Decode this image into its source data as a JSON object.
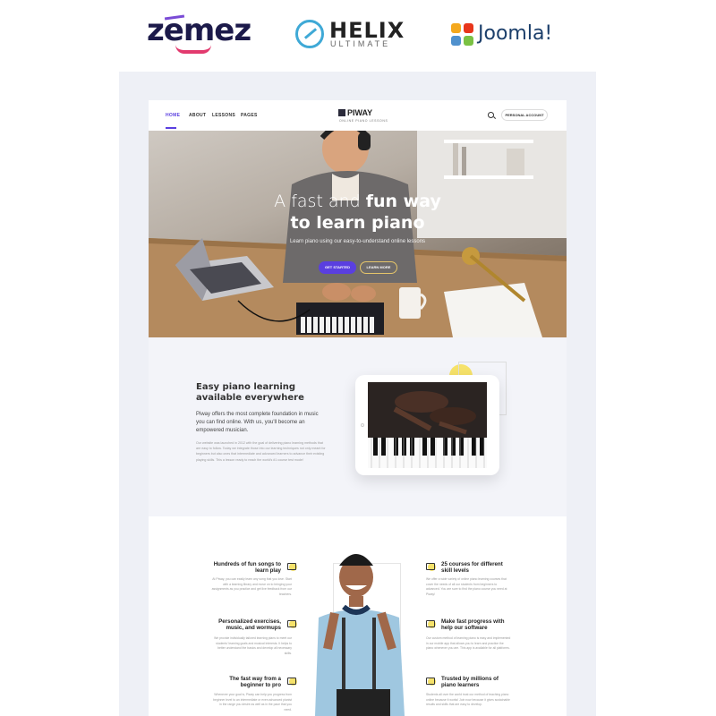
{
  "brands": {
    "zemez": "zemez",
    "helix": "HELIX",
    "helix_sub": "ULTIMATE",
    "joomla": "Joomla!"
  },
  "nav": {
    "items": [
      "Home",
      "About",
      "Lessons",
      "Pages"
    ],
    "active": "Home",
    "logo": "PIWAY",
    "logo_tagline": "ONLINE PIANO LESSONS",
    "account": "PERSONAL ACCOUNT",
    "search_icon": "search-icon"
  },
  "hero": {
    "title_light": "A fast and ",
    "title_bold": "fun way",
    "title_line2": "to learn piano",
    "subtitle": "Learn piano using our easy-to-understand online lessons",
    "btn_primary": "GET STARTED",
    "btn_secondary": "LEARN MORE"
  },
  "about": {
    "title": "Easy piano learning available everywhere",
    "lead": "Piway offers the most complete foundation in music you can find online. With us, you'll become an empowered musician.",
    "body": "Our website was launched in 2012 with the goal of delivering piano learning methods that are easy to follow. Today we integrate those into our learning techniques not only meant for beginners but also ones that intermediate and advanced learners to advance their existing playing skills. This a lesson ready to reach the world's #1 course test mode!"
  },
  "features": {
    "left": [
      {
        "title": "Hundreds of fun songs to learn play",
        "text": "At Piway, you can easily learn any song that you love. Start with a learning library and move on to bringing your assignments as you practice and get live feedback from our teachers."
      },
      {
        "title": "Personalized exercises, music, and wormups",
        "text": "We provide individually tailored learning plans to meet our students' learning goals and musical interests. It helps to better understand the basics and develop all necessary skills."
      },
      {
        "title": "The fast way from a beginner to pro",
        "text": "Whenever your goal is, Piway can help you progress from beginner level to an intermediate or even advanced pianist in the range you desire as well as in the pace that you need."
      }
    ],
    "right": [
      {
        "title": "25 courses for different skill levels",
        "text": "We offer a wide variety of online piano learning courses that cover the needs of all our students from beginners to advanced. You are sure to find the piano course you need at Piway!"
      },
      {
        "title": "Make fast progress with help our software",
        "text": "Our custom method of learning piano is easy and implemented in our mobile app that allows you to learn and practice the piano whenever you are. This app is available for all platforms."
      },
      {
        "title": "Trusted by millions of piano learners",
        "text": "Students all over the world trust our method of teaching piano online because it works! Join now because it gives sustainable results and skills that are easy to develop."
      }
    ]
  }
}
